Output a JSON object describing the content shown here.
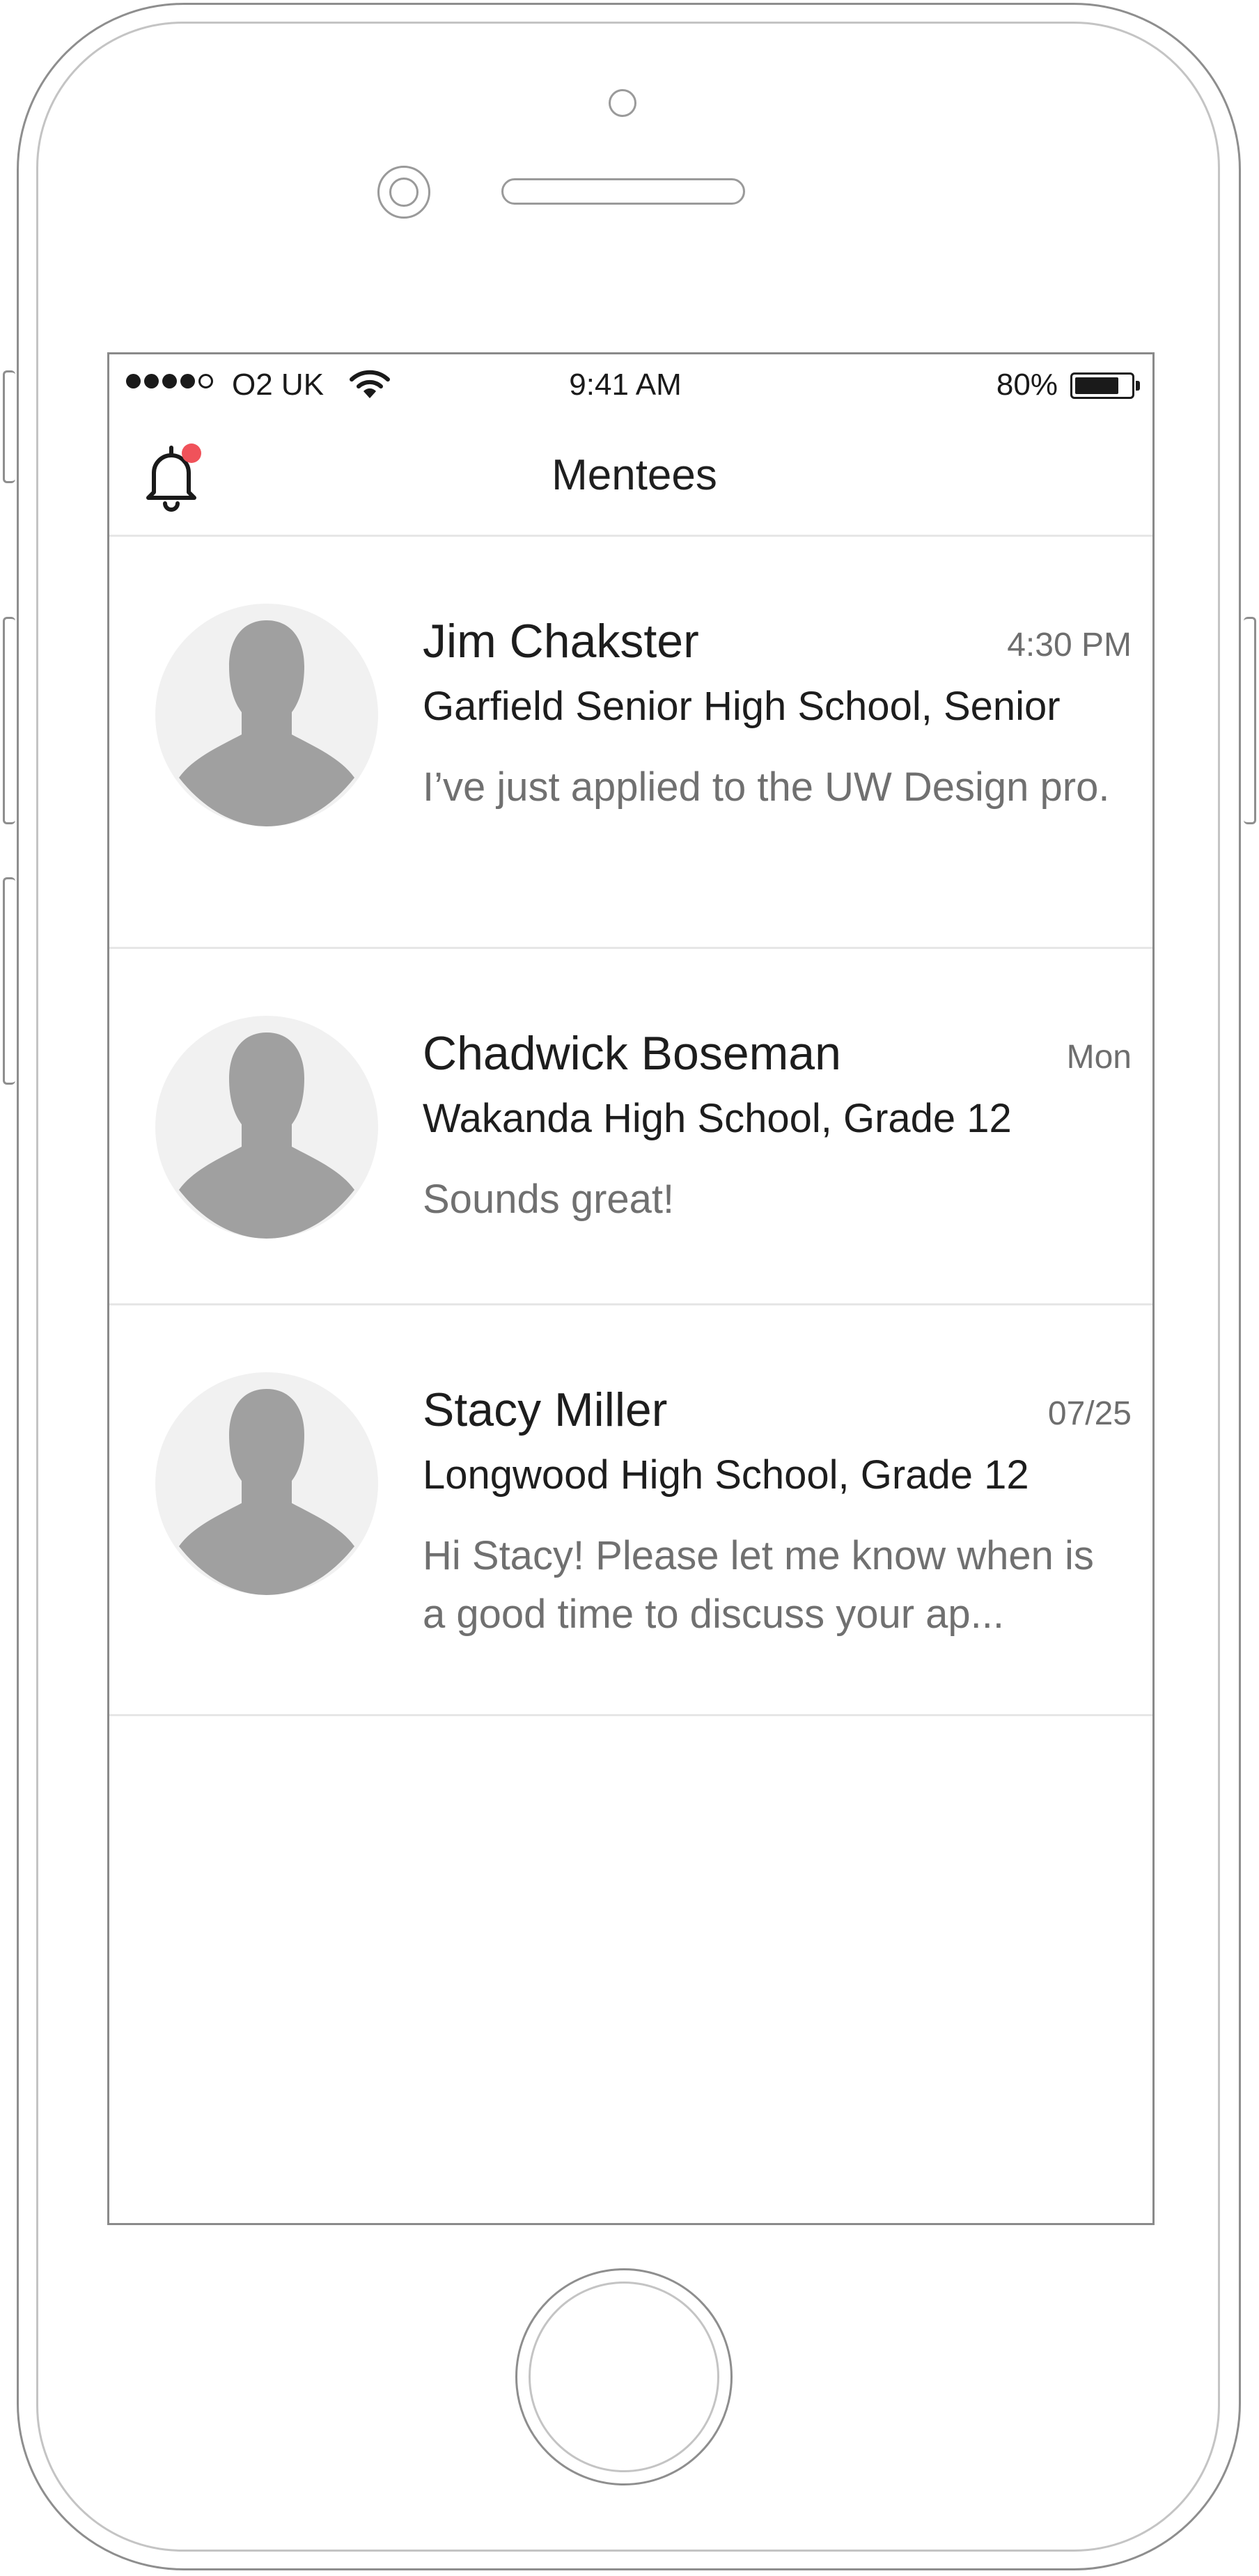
{
  "status_bar": {
    "carrier": "O2 UK",
    "time": "9:41 AM",
    "battery_percent_label": "80%",
    "battery_level": 0.8,
    "signal_bars_filled": 4,
    "signal_bars_total": 5
  },
  "nav": {
    "title": "Mentees",
    "notification_icon": "bell-icon",
    "has_unread_notification": true
  },
  "mentees": [
    {
      "name": "Jim Chakster",
      "time": "4:30 PM",
      "school": "Garfield Senior High School, Senior",
      "preview": "I’ve just applied to the UW Design pro."
    },
    {
      "name": "Chadwick Boseman",
      "time": "Mon",
      "school": "Wakanda High School, Grade 12",
      "preview": "Sounds great!"
    },
    {
      "name": "Stacy Miller",
      "time": "07/25",
      "school": "Longwood High School, Grade 12",
      "preview": "Hi Stacy! Please let me know when is a good time to discuss your ap..."
    }
  ],
  "colors": {
    "notification_dot": "#f0525a",
    "avatar_bg": "#f1f1f1",
    "avatar_silhouette": "#a0a0a0",
    "secondary_text": "#707070",
    "divider": "#e6e6e6"
  }
}
